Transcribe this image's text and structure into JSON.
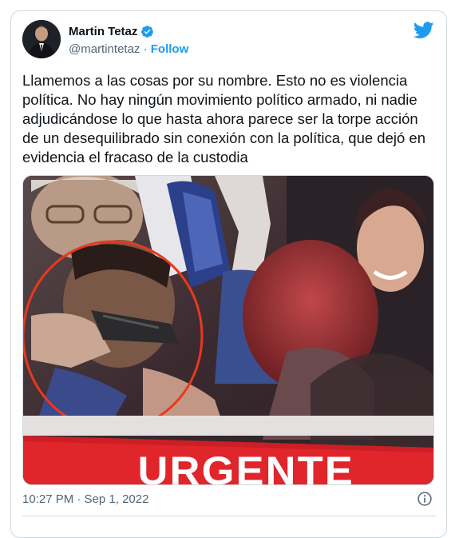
{
  "author": {
    "display_name": "Martin Tetaz",
    "handle": "@martintetaz",
    "separator": " · ",
    "follow_label": "Follow"
  },
  "tweet": {
    "text": "Llamemos a las cosas por su nombre. Esto no es violencia política. No hay ningún movimiento político armado, ni nadie adjudicándose lo que hasta ahora parece ser la torpe acción de un desequilibrado sin conexión con la política, que dejó en evidencia el fracaso de la custodia",
    "timestamp": "10:27 PM · Sep 1, 2022"
  },
  "media": {
    "banner_text": "URGENTE"
  },
  "icons": {
    "verified": "verified-badge-icon",
    "twitter": "twitter-bird-icon",
    "info": "info-icon"
  },
  "colors": {
    "accent": "#1d9bf0",
    "banner_red": "#e0252b",
    "circle": "#e8391f"
  }
}
